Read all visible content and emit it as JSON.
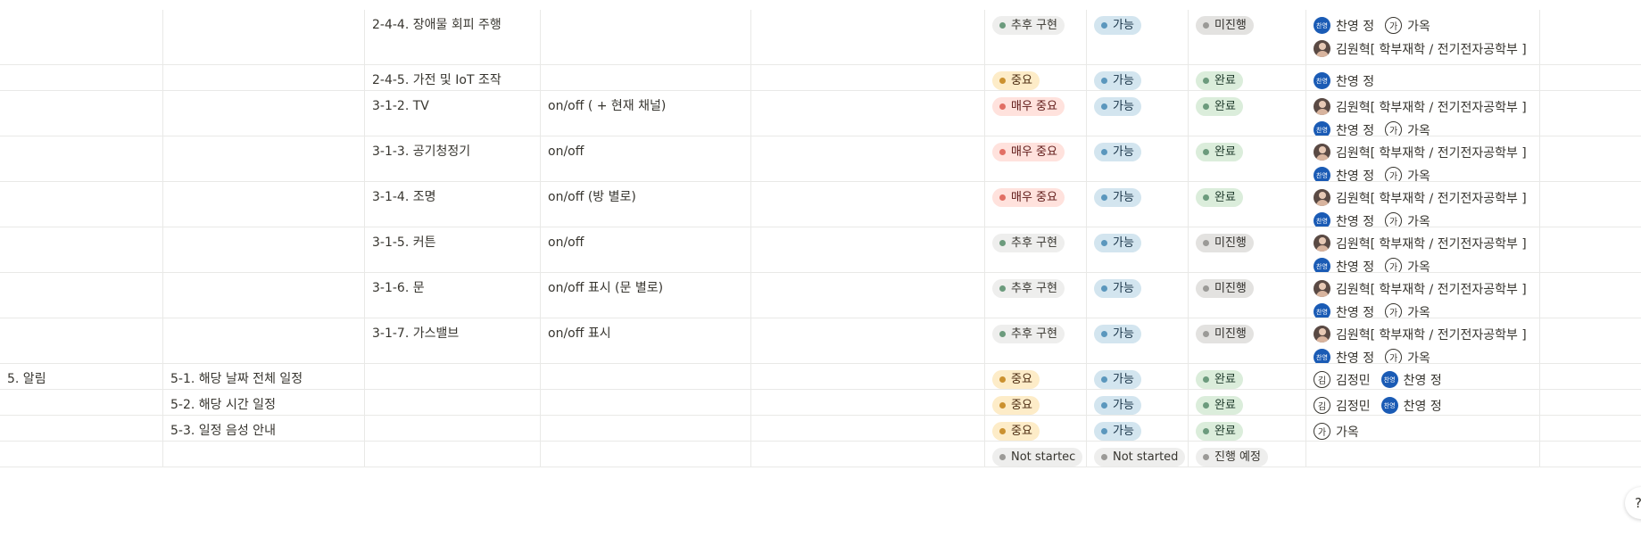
{
  "rows": [
    {
      "c0": "",
      "c1": "",
      "c2": "2-4-4. 장애물 회피 주행",
      "c3": "",
      "priority": {
        "label": "추후 구현",
        "color": "green2"
      },
      "feasible": {
        "label": "가능",
        "color": "blue"
      },
      "status": {
        "label": "미진행",
        "color": "darkgray"
      },
      "lines": [
        [
          {
            "name": "찬영 정",
            "avatar": "찬영",
            "type": "blue"
          },
          {
            "name": "가옥",
            "avatar": "가",
            "type": "outline"
          }
        ],
        [
          {
            "name": "김원혁[ 학부재학 / 전기전자공학부 ]",
            "avatar": "",
            "type": "photo"
          }
        ]
      ]
    },
    {
      "c0": "",
      "c1": "",
      "c2": "2-4-5. 가전 및 IoT 조작",
      "c3": "",
      "priority": {
        "label": "중요",
        "color": "orange"
      },
      "feasible": {
        "label": "가능",
        "color": "blue"
      },
      "status": {
        "label": "완료",
        "color": "green"
      },
      "lines": [
        [
          {
            "name": "찬영 정",
            "avatar": "찬영",
            "type": "blue"
          }
        ]
      ]
    },
    {
      "c0": "",
      "c1": "",
      "c2": "3-1-2. TV",
      "c3": "on/off ( + 현재 채널)",
      "priority": {
        "label": "매우 중요",
        "color": "red"
      },
      "feasible": {
        "label": "가능",
        "color": "blue"
      },
      "status": {
        "label": "완료",
        "color": "green"
      },
      "lines": [
        [
          {
            "name": "김원혁[ 학부재학 / 전기전자공학부 ]",
            "avatar": "",
            "type": "photo"
          }
        ],
        [
          {
            "name": "찬영 정",
            "avatar": "찬영",
            "type": "blue"
          },
          {
            "name": "가옥",
            "avatar": "가",
            "type": "outline"
          }
        ]
      ]
    },
    {
      "c0": "",
      "c1": "",
      "c2": "3-1-3. 공기청정기",
      "c3": "on/off",
      "priority": {
        "label": "매우 중요",
        "color": "red"
      },
      "feasible": {
        "label": "가능",
        "color": "blue"
      },
      "status": {
        "label": "완료",
        "color": "green"
      },
      "lines": [
        [
          {
            "name": "김원혁[ 학부재학 / 전기전자공학부 ]",
            "avatar": "",
            "type": "photo"
          }
        ],
        [
          {
            "name": "찬영 정",
            "avatar": "찬영",
            "type": "blue"
          },
          {
            "name": "가옥",
            "avatar": "가",
            "type": "outline"
          }
        ]
      ]
    },
    {
      "c0": "",
      "c1": "",
      "c2": "3-1-4. 조명",
      "c3": "on/off (방 별로)",
      "priority": {
        "label": "매우 중요",
        "color": "red"
      },
      "feasible": {
        "label": "가능",
        "color": "blue"
      },
      "status": {
        "label": "완료",
        "color": "green"
      },
      "lines": [
        [
          {
            "name": "김원혁[ 학부재학 / 전기전자공학부 ]",
            "avatar": "",
            "type": "photo"
          }
        ],
        [
          {
            "name": "찬영 정",
            "avatar": "찬영",
            "type": "blue"
          },
          {
            "name": "가옥",
            "avatar": "가",
            "type": "outline"
          }
        ]
      ]
    },
    {
      "c0": "",
      "c1": "",
      "c2": "3-1-5. 커튼",
      "c3": "on/off",
      "priority": {
        "label": "추후 구현",
        "color": "green2"
      },
      "feasible": {
        "label": "가능",
        "color": "blue"
      },
      "status": {
        "label": "미진행",
        "color": "darkgray"
      },
      "lines": [
        [
          {
            "name": "김원혁[ 학부재학 / 전기전자공학부 ]",
            "avatar": "",
            "type": "photo"
          }
        ],
        [
          {
            "name": "찬영 정",
            "avatar": "찬영",
            "type": "blue"
          },
          {
            "name": "가옥",
            "avatar": "가",
            "type": "outline"
          }
        ]
      ]
    },
    {
      "c0": "",
      "c1": "",
      "c2": "3-1-6. 문",
      "c3": "on/off 표시 (문 별로)",
      "priority": {
        "label": "추후 구현",
        "color": "green2"
      },
      "feasible": {
        "label": "가능",
        "color": "blue"
      },
      "status": {
        "label": "미진행",
        "color": "darkgray"
      },
      "lines": [
        [
          {
            "name": "김원혁[ 학부재학 / 전기전자공학부 ]",
            "avatar": "",
            "type": "photo"
          }
        ],
        [
          {
            "name": "찬영 정",
            "avatar": "찬영",
            "type": "blue"
          },
          {
            "name": "가옥",
            "avatar": "가",
            "type": "outline"
          }
        ]
      ]
    },
    {
      "c0": "",
      "c1": "",
      "c2": "3-1-7. 가스밸브",
      "c3": "on/off 표시",
      "priority": {
        "label": "추후 구현",
        "color": "green2"
      },
      "feasible": {
        "label": "가능",
        "color": "blue"
      },
      "status": {
        "label": "미진행",
        "color": "darkgray"
      },
      "lines": [
        [
          {
            "name": "김원혁[ 학부재학 / 전기전자공학부 ]",
            "avatar": "",
            "type": "photo"
          }
        ],
        [
          {
            "name": "찬영 정",
            "avatar": "찬영",
            "type": "blue"
          },
          {
            "name": "가옥",
            "avatar": "가",
            "type": "outline"
          }
        ]
      ]
    },
    {
      "c0": "5. 알림",
      "c1": "5-1. 해당 날짜 전체 일정",
      "c2": "",
      "c3": "",
      "priority": {
        "label": "중요",
        "color": "orange"
      },
      "feasible": {
        "label": "가능",
        "color": "blue"
      },
      "status": {
        "label": "완료",
        "color": "green"
      },
      "lines": [
        [
          {
            "name": "김정민",
            "avatar": "김",
            "type": "outline"
          },
          {
            "name": "찬영 정",
            "avatar": "찬영",
            "type": "blue"
          }
        ]
      ]
    },
    {
      "c0": "",
      "c1": "5-2. 해당 시간 일정",
      "c2": "",
      "c3": "",
      "priority": {
        "label": "중요",
        "color": "orange"
      },
      "feasible": {
        "label": "가능",
        "color": "blue"
      },
      "status": {
        "label": "완료",
        "color": "green"
      },
      "lines": [
        [
          {
            "name": "김정민",
            "avatar": "김",
            "type": "outline"
          },
          {
            "name": "찬영 정",
            "avatar": "찬영",
            "type": "blue"
          }
        ]
      ]
    },
    {
      "c0": "",
      "c1": "5-3. 일정 음성 안내",
      "c2": "",
      "c3": "",
      "priority": {
        "label": "중요",
        "color": "orange"
      },
      "feasible": {
        "label": "가능",
        "color": "blue"
      },
      "status": {
        "label": "완료",
        "color": "green"
      },
      "lines": [
        [
          {
            "name": "가옥",
            "avatar": "가",
            "type": "outline"
          }
        ]
      ]
    },
    {
      "c0": "",
      "c1": "",
      "c2": "",
      "c3": "",
      "priority": {
        "label": "Not startec",
        "color": "gray"
      },
      "feasible": {
        "label": "Not started",
        "color": "gray"
      },
      "status": {
        "label": "진행 예정",
        "color": "gray"
      },
      "lines": []
    }
  ],
  "help": {
    "label": "?"
  }
}
